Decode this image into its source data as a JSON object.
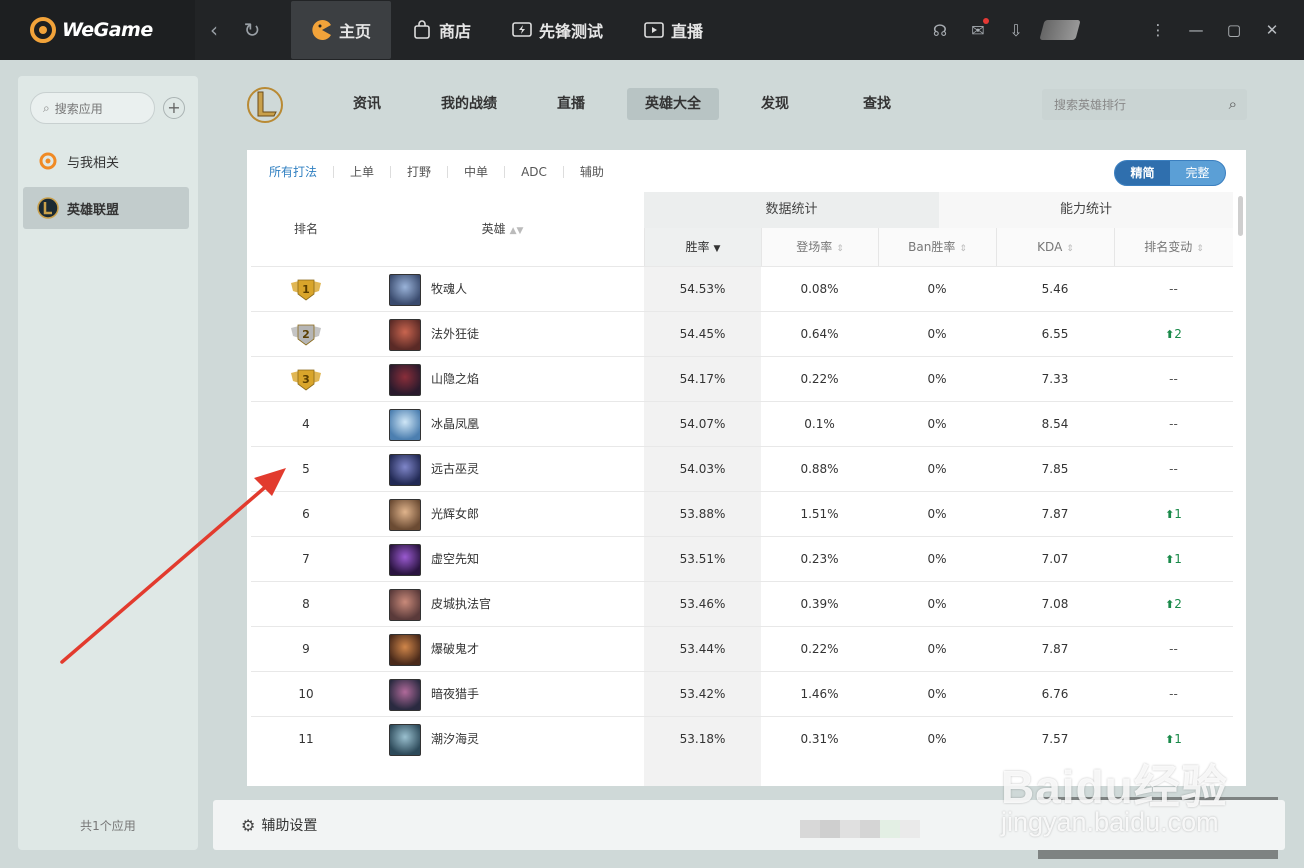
{
  "app": {
    "name": "WeGame"
  },
  "topbar": {
    "tabs": [
      {
        "label": "主页",
        "icon": "pacman-home-icon"
      },
      {
        "label": "商店",
        "icon": "shopping-bag-icon"
      },
      {
        "label": "先锋测试",
        "icon": "lightning-monitor-icon"
      },
      {
        "label": "直播",
        "icon": "play-icon"
      }
    ],
    "active_tab": "主页"
  },
  "sidebar": {
    "search_placeholder": "搜索应用",
    "items": [
      {
        "label": "与我相关",
        "icon": "wegame-mine-icon"
      },
      {
        "label": "英雄联盟",
        "icon": "lol-icon"
      }
    ],
    "footer": "共1个应用"
  },
  "subnav": {
    "tabs": [
      "资讯",
      "我的战绩",
      "直播",
      "英雄大全",
      "发现",
      "查找"
    ],
    "active": "英雄大全",
    "search_placeholder": "搜索英雄排行"
  },
  "table": {
    "lanes": [
      "所有打法",
      "上单",
      "打野",
      "中单",
      "ADC",
      "辅助"
    ],
    "mode": {
      "brief": "精简",
      "full": "完整"
    },
    "groups": {
      "data": "数据统计",
      "ability": "能力统计"
    },
    "headers": {
      "rank": "排名",
      "hero": "英雄",
      "win": "胜率",
      "pick": "登场率",
      "ban": "Ban胜率",
      "kda": "KDA",
      "change": "排名变动"
    },
    "rows": [
      {
        "rank": "1",
        "hero": "牧魂人",
        "win": "54.53%",
        "pick": "0.08%",
        "ban": "0%",
        "kda": "5.46",
        "change": "--"
      },
      {
        "rank": "2",
        "hero": "法外狂徒",
        "win": "54.45%",
        "pick": "0.64%",
        "ban": "0%",
        "kda": "6.55",
        "change": "2",
        "up": true
      },
      {
        "rank": "3",
        "hero": "山隐之焰",
        "win": "54.17%",
        "pick": "0.22%",
        "ban": "0%",
        "kda": "7.33",
        "change": "--"
      },
      {
        "rank": "4",
        "hero": "冰晶凤凰",
        "win": "54.07%",
        "pick": "0.1%",
        "ban": "0%",
        "kda": "8.54",
        "change": "--"
      },
      {
        "rank": "5",
        "hero": "远古巫灵",
        "win": "54.03%",
        "pick": "0.88%",
        "ban": "0%",
        "kda": "7.85",
        "change": "--"
      },
      {
        "rank": "6",
        "hero": "光辉女郎",
        "win": "53.88%",
        "pick": "1.51%",
        "ban": "0%",
        "kda": "7.87",
        "change": "1",
        "up": true
      },
      {
        "rank": "7",
        "hero": "虚空先知",
        "win": "53.51%",
        "pick": "0.23%",
        "ban": "0%",
        "kda": "7.07",
        "change": "1",
        "up": true
      },
      {
        "rank": "8",
        "hero": "皮城执法官",
        "win": "53.46%",
        "pick": "0.39%",
        "ban": "0%",
        "kda": "7.08",
        "change": "2",
        "up": true
      },
      {
        "rank": "9",
        "hero": "爆破鬼才",
        "win": "53.44%",
        "pick": "0.22%",
        "ban": "0%",
        "kda": "7.87",
        "change": "--"
      },
      {
        "rank": "10",
        "hero": "暗夜猎手",
        "win": "53.42%",
        "pick": "1.46%",
        "ban": "0%",
        "kda": "6.76",
        "change": "--"
      },
      {
        "rank": "11",
        "hero": "潮汐海灵",
        "win": "53.18%",
        "pick": "0.31%",
        "ban": "0%",
        "kda": "7.57",
        "change": "1",
        "up": true
      }
    ]
  },
  "bottom": {
    "settings_label": "辅助设置"
  },
  "watermark": {
    "brand": "Baidu经验",
    "url": "jingyan.baidu.com"
  },
  "colors": {
    "accent": "#2f7fc1",
    "up": "#1a8a4a",
    "gold": "#d9a52b",
    "silver": "#b5b5b5"
  }
}
